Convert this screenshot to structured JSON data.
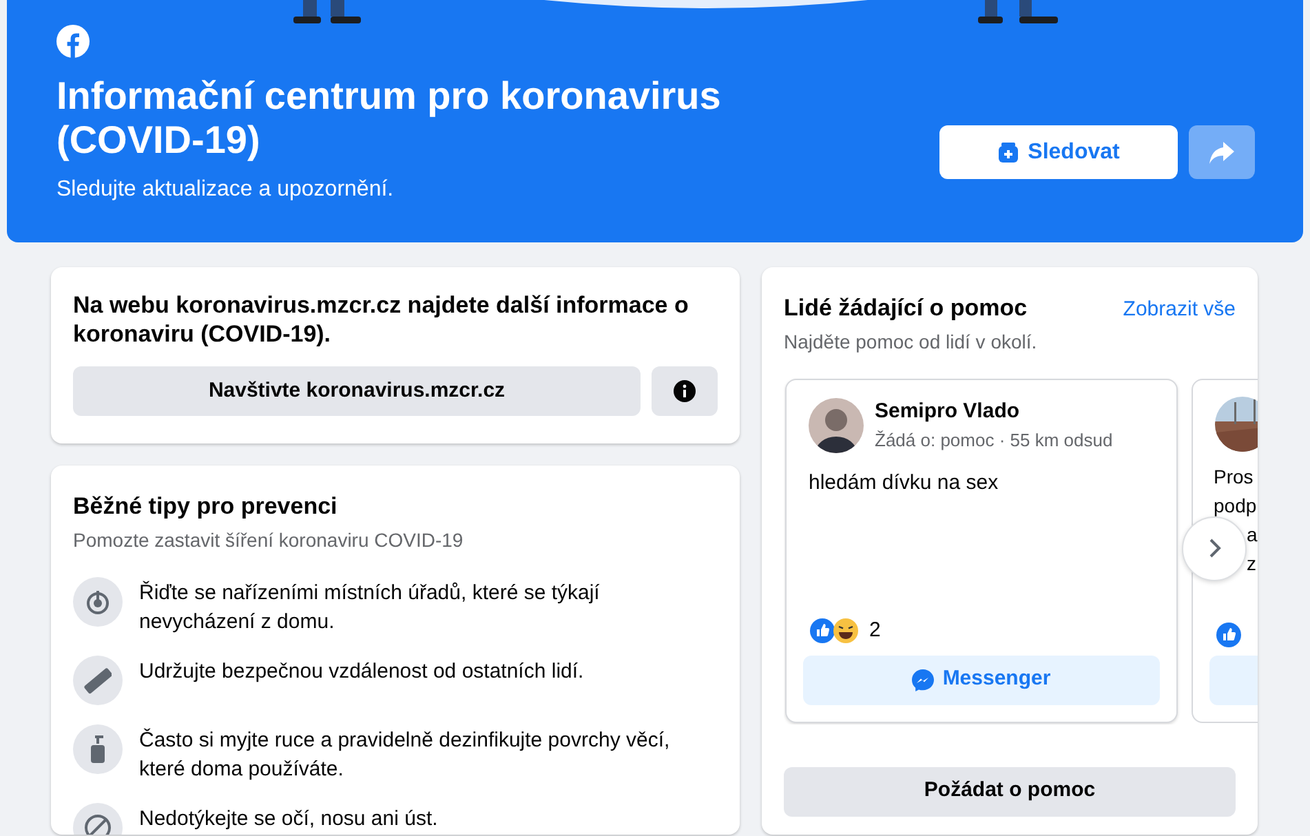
{
  "header": {
    "title": "Informační centrum pro koronavirus (COVID-19)",
    "subtitle": "Sledujte aktualizace a upozornění.",
    "follow_button": "Sledovat"
  },
  "info_card": {
    "text": "Na webu koronavirus.mzcr.cz najdete další informace o koronaviru (COVID-19).",
    "button": "Navštivte koronavirus.mzcr.cz"
  },
  "tips": {
    "title": "Běžné tipy pro prevenci",
    "subtitle": "Pomozte zastavit šíření koronaviru COVID-19",
    "items": [
      {
        "kind": "home",
        "text": "Řiďte se nařízeními místních úřadů, které se týkají nevycházení z domu."
      },
      {
        "kind": "ruler",
        "text": "Udržujte bezpečnou vzdálenost od ostatních lidí."
      },
      {
        "kind": "soap",
        "text": "Často si myjte ruce a pravidelně dezinfikujte povrchy věcí, které doma používáte."
      },
      {
        "kind": "forbid",
        "text": "Nedotýkejte se očí, nosu ani úst."
      }
    ]
  },
  "help": {
    "title": "Lidé žádající o pomoc",
    "link": "Zobrazit vše",
    "subtitle": "Najděte pomoc od lidí v okolí.",
    "cards": [
      {
        "kind": "full",
        "name": "Semipro Vlado",
        "meta": "Žádá o: pomoc · 55 km odsud",
        "text": "hledám dívku na sex",
        "reactions": [
          {
            "kind": "like"
          },
          {
            "kind": "haha"
          }
        ],
        "count": "2",
        "button": "Messenger"
      },
      {
        "kind": "partial",
        "text_lines": [
          "Pros",
          "podp",
          "a",
          "z"
        ],
        "reactions": [
          {
            "kind": "like"
          }
        ]
      }
    ],
    "request_button": "Požádat o pomoc"
  }
}
